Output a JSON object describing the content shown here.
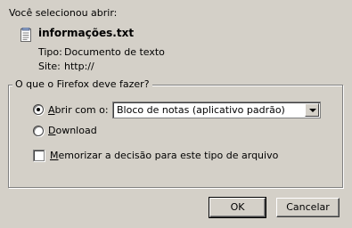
{
  "dialog": {
    "intro": "Você selecionou abrir:",
    "file": {
      "icon": "text-file-icon",
      "name": "informações.txt",
      "type_label": "Tipo:",
      "type_value": "Documento de texto",
      "site_label": "Site:",
      "site_value": "http://"
    },
    "group": {
      "title": "O que o Firefox deve fazer?",
      "open_with": {
        "label_underlined": "A",
        "label_rest": "brir com o:",
        "selected": true
      },
      "app_select": {
        "value": "Bloco de notas (aplicativo padrão)"
      },
      "download": {
        "label_underlined": "D",
        "label_rest": "ownload",
        "selected": false
      },
      "remember": {
        "label_underlined": "M",
        "label_rest": "emorizar a decisão para este tipo de arquivo",
        "checked": false
      }
    },
    "buttons": {
      "ok": "OK",
      "cancel": "Cancelar"
    }
  }
}
